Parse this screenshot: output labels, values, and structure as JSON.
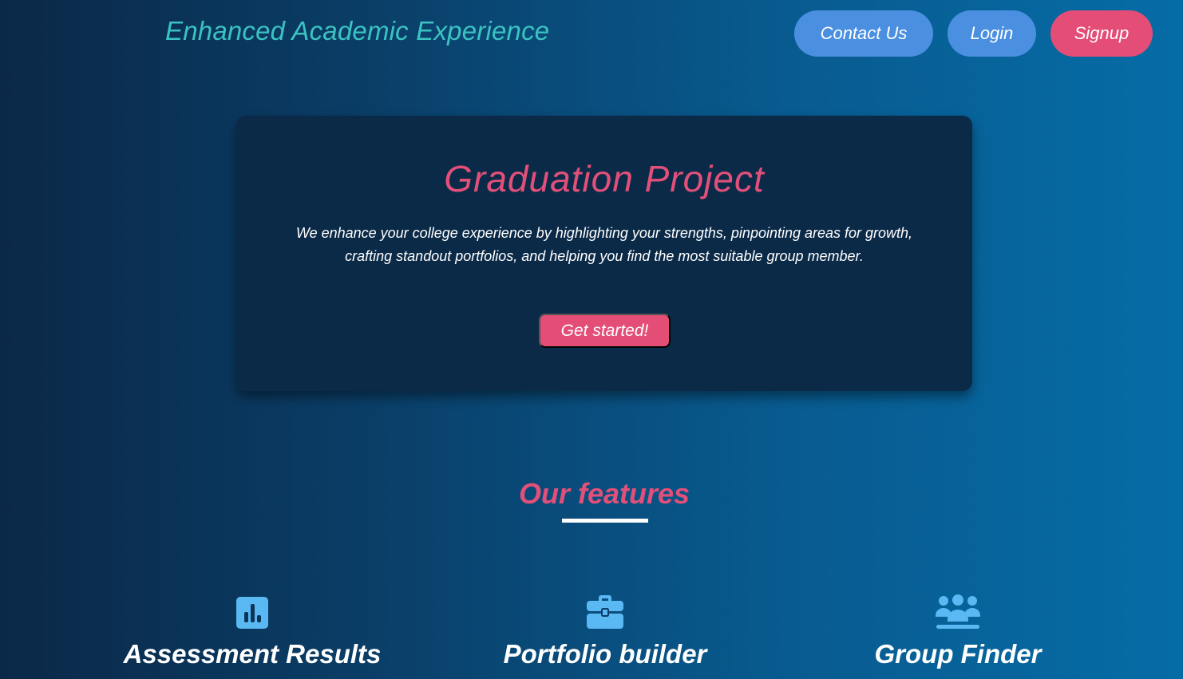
{
  "header": {
    "brand": "Enhanced Academic Experience",
    "nav": {
      "contact": "Contact Us",
      "login": "Login",
      "signup": "Signup"
    }
  },
  "hero": {
    "title": "Graduation Project",
    "description": "We enhance your college experience by highlighting your strengths, pinpointing areas for growth, crafting standout portfolios, and helping you find the most suitable group member.",
    "cta": "Get started!"
  },
  "features": {
    "title": "Our features",
    "items": [
      {
        "label": "Assessment Results",
        "icon": "bar-chart-icon"
      },
      {
        "label": "Portfolio builder",
        "icon": "briefcase-icon"
      },
      {
        "label": "Group Finder",
        "icon": "users-icon"
      }
    ]
  },
  "colors": {
    "brand": "#3bc3c2",
    "accent_pink": "#e34d76",
    "accent_blue": "#4a8fe0",
    "icon_blue": "#5ab8f2",
    "card": "#0b2a48"
  }
}
